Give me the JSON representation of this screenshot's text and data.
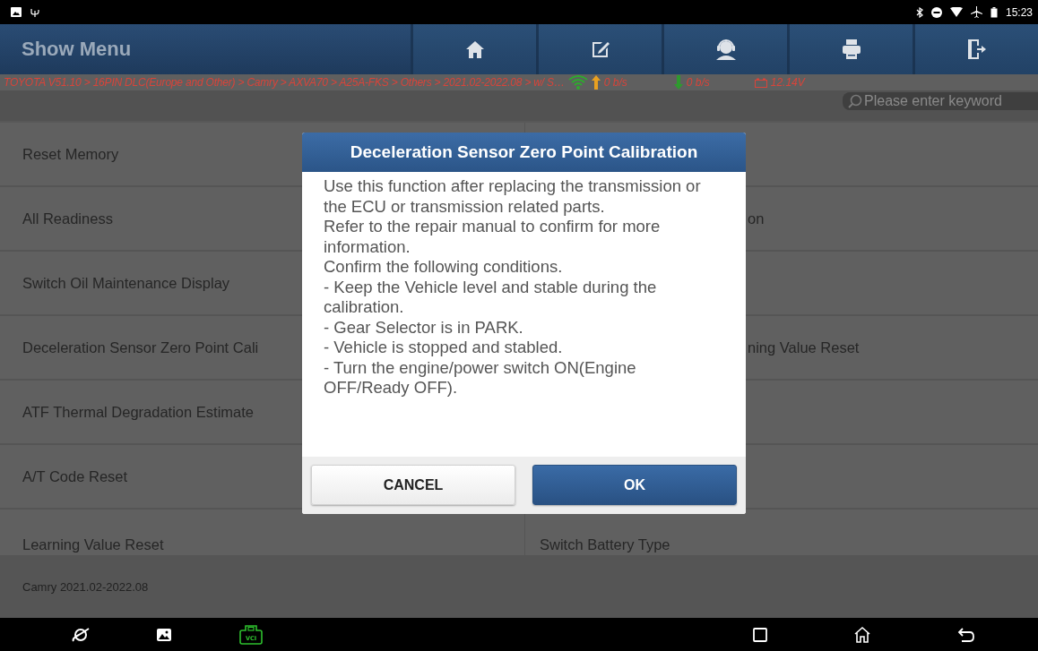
{
  "status_bar": {
    "time": "15:23"
  },
  "header": {
    "title": "Show Menu",
    "buttons": [
      {
        "kind": "home"
      },
      {
        "kind": "edit"
      },
      {
        "kind": "support"
      },
      {
        "kind": "print"
      },
      {
        "kind": "exit"
      }
    ]
  },
  "breadcrumb": {
    "path": "TOYOTA V51.10 > 16PIN DLC(Europe and Other) > Camry > AXVA70 > A25A-FKS > Others > 2021.02-2022.08 > w/ S…",
    "upload": "0 b/s",
    "download": "0 b/s",
    "voltage": "12.14V"
  },
  "search": {
    "placeholder": "Please enter keyword"
  },
  "menu_rows": [
    {
      "left": "Reset Memory"
    },
    {
      "left": "All Readiness",
      "right": "on",
      "right_covered": true
    },
    {
      "left": "Switch Oil Maintenance Display"
    },
    {
      "left": "Deceleration Sensor Zero Point Cali",
      "right": "ning Value Reset",
      "right_covered": true
    },
    {
      "left": "ATF Thermal Degradation Estimate"
    },
    {
      "left": "A/T Code Reset"
    },
    {
      "left": "Learning Value Reset",
      "right": "Switch Battery Type",
      "right_covered": false
    }
  ],
  "footer": {
    "vehicle": "Camry 2021.02-2022.08"
  },
  "dialog": {
    "title": "Deceleration Sensor Zero Point Calibration",
    "paragraphs": [
      "Use this function after replacing the transmission or the ECU or transmission related parts.",
      "Refer to the repair manual to confirm for more information.",
      "Confirm the following conditions.",
      "- Keep the Vehicle level and stable during the calibration.",
      "- Gear Selector is in PARK.",
      "- Vehicle is stopped and stabled.",
      "- Turn the engine/power switch ON(Engine OFF/Ready OFF)."
    ],
    "buttons": [
      {
        "label": "CANCEL",
        "kind": "secondary"
      },
      {
        "label": "OK",
        "kind": "primary"
      }
    ]
  },
  "nav_bar": {
    "vci_label": "VCI"
  }
}
